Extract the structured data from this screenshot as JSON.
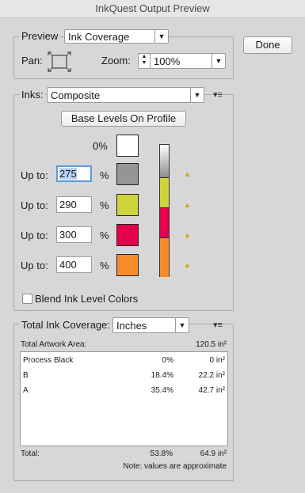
{
  "window": {
    "title": "InkQuest Output Preview"
  },
  "preview": {
    "label": "Preview",
    "mode": "Ink Coverage",
    "pan_label": "Pan:",
    "zoom_label": "Zoom:",
    "zoom_value": "100%"
  },
  "done_button": "Done",
  "inks": {
    "label": "Inks:",
    "mode": "Composite",
    "base_levels_button": "Base Levels On Profile",
    "zero_label": "0%",
    "up_to_label": "Up to:",
    "pct_sign": "%",
    "rows": [
      {
        "value": "275",
        "color": "#959595"
      },
      {
        "value": "290",
        "color": "#cfd33c"
      },
      {
        "value": "300",
        "color": "#e4004d"
      },
      {
        "value": "400",
        "color": "#f68b2b"
      }
    ],
    "zero_color": "#ffffff",
    "blend_label": "Blend Ink Level Colors",
    "blend_checked": false
  },
  "coverage": {
    "label": "Total Ink Coverage:",
    "unit": "Inches",
    "artwork_area_label": "Total Artwork Area:",
    "artwork_area_value": "120.5 in²",
    "rows": [
      {
        "name": "Process Black",
        "percent": "0%",
        "area": "0 in²"
      },
      {
        "name": "B",
        "percent": "18.4%",
        "area": "22.2 in²"
      },
      {
        "name": "A",
        "percent": "35.4%",
        "area": "42.7 in²"
      }
    ],
    "total_label": "Total:",
    "total_percent": "53.8%",
    "total_area": "64.9 in²",
    "note": "Note: values are approximate"
  }
}
